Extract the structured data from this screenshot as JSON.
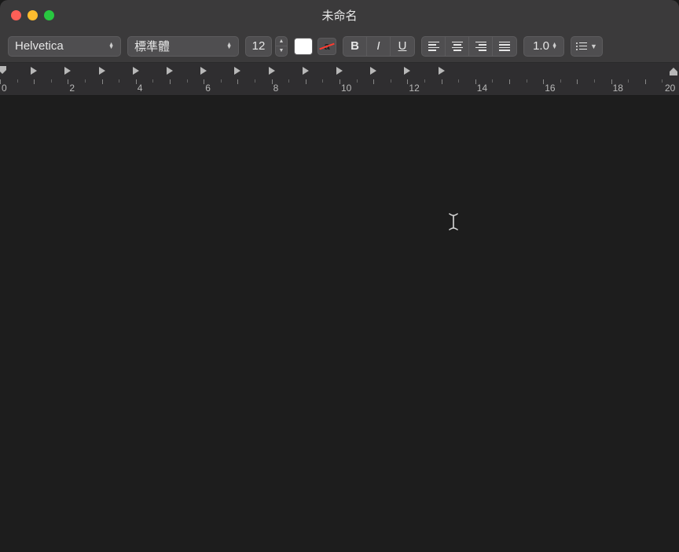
{
  "window": {
    "title": "未命名"
  },
  "toolbar": {
    "font_family": "Helvetica",
    "font_style": "標準體",
    "font_size": "12",
    "bold_label": "B",
    "italic_label": "I",
    "underline_label": "U",
    "line_spacing": "1.0",
    "text_color": "#ffffff",
    "strike_letter": "a"
  },
  "ruler": {
    "major_labels": [
      "0",
      "2",
      "4",
      "6",
      "8",
      "10",
      "12",
      "14",
      "16",
      "18",
      "20"
    ],
    "tab_stop_count": 13
  }
}
